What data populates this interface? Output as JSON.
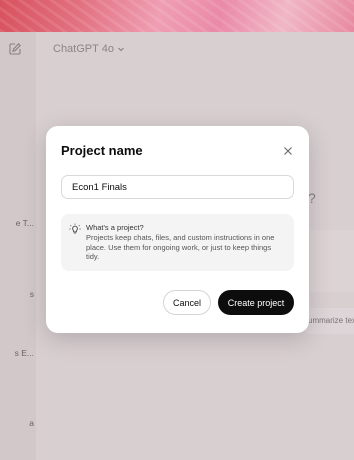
{
  "header": {
    "model_label": "ChatGPT 4o"
  },
  "sidebar": {
    "items": [
      {
        "label": "e T..."
      },
      {
        "label": "s"
      },
      {
        "label": "s E..."
      },
      {
        "label": "a"
      }
    ]
  },
  "main": {
    "heading_fragment": "?",
    "input_placeholder_fragment": "ummarize tex"
  },
  "dialog": {
    "title": "Project name",
    "name_value": "Econ1 Finals",
    "info_title": "What's a project?",
    "info_body": "Projects keep chats, files, and custom instructions in one place. Use them for ongoing work, or just to keep things tidy.",
    "cancel_label": "Cancel",
    "create_label": "Create project"
  },
  "icons": {
    "edit": "edit-icon",
    "chevron": "chevron-down-icon",
    "close": "close-icon",
    "lightbulb": "lightbulb-icon"
  }
}
